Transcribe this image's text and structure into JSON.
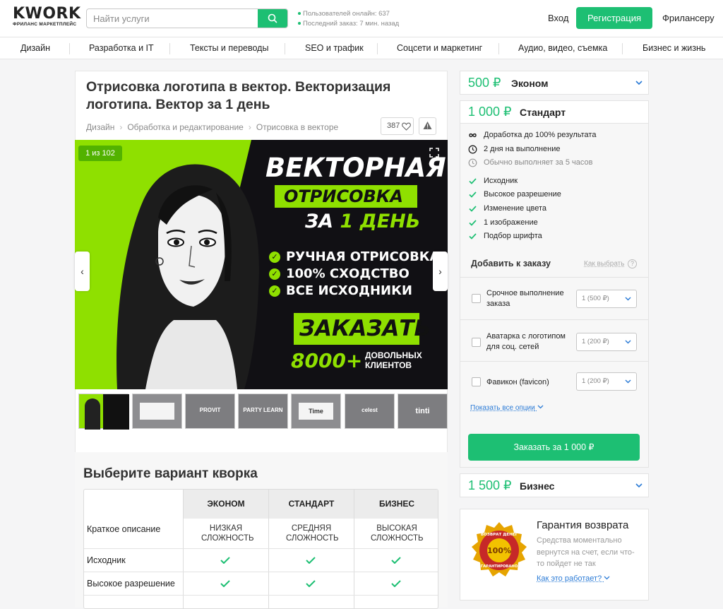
{
  "header": {
    "logo": "KWORK",
    "logo_sub": "ФРИЛАНС МАРКЕТПЛЕЙС",
    "search_placeholder": "Найти услуги",
    "stats_online": "Пользователей онлайн: 637",
    "stats_last_order": "Последний заказ: 7 мин. назад",
    "login": "Вход",
    "register": "Регистрация",
    "freelancer": "Фрилансеру"
  },
  "categories": [
    "Дизайн",
    "Разработка и IT",
    "Тексты и переводы",
    "SEO и трафик",
    "Соцсети и маркетинг",
    "Аудио, видео, съемка",
    "Бизнес и жизнь"
  ],
  "kwork": {
    "title": "Отрисовка логотипа в вектор. Векторизация логотипа. Вектор за 1 день",
    "breadcrumbs": [
      "Дизайн",
      "Обработка и редактирование",
      "Отрисовка в векторе"
    ],
    "favorites": "387",
    "gallery_counter": "1 из 102"
  },
  "banner": {
    "line1": "ВЕКТОРНАЯ",
    "line2": "ОТРИСОВКА",
    "line3a": "ЗА",
    "line3b": "1",
    "line3c": "ДЕНЬ",
    "bullets": [
      "РУЧНАЯ ОТРИСОВКА",
      "100% СХОДСТВО",
      "ВСЕ ИСХОДНИКИ"
    ],
    "cta": "ЗАКАЗАТЬ",
    "clients_num": "8000+",
    "clients_text1": "ДОВОЛЬНЫХ",
    "clients_text2": "КЛИЕНТОВ"
  },
  "thumbs": [
    "",
    "",
    "PROVIT",
    "PARTY LEARN",
    "Time",
    "celest",
    "tinti"
  ],
  "packages": {
    "title": "Выберите вариант кворка",
    "columns": [
      "ЭКОНОМ",
      "СТАНДАРТ",
      "БИЗНЕС"
    ],
    "rows": [
      {
        "label": "Краткое описание",
        "values": [
          "НИЗКАЯ СЛОЖНОСТЬ",
          "СРЕДНЯЯ СЛОЖНОСТЬ",
          "ВЫСОКАЯ СЛОЖНОСТЬ"
        ]
      },
      {
        "label": "Исходник",
        "values": [
          "check",
          "check",
          "check"
        ]
      },
      {
        "label": "Высокое разрешение",
        "values": [
          "check",
          "check",
          "check"
        ]
      }
    ]
  },
  "tiers": {
    "econom": {
      "price": "500 ₽",
      "name": "Эконом"
    },
    "standard": {
      "price": "1 000 ₽",
      "name": "Стандарт"
    },
    "business": {
      "price": "1 500 ₽",
      "name": "Бизнес"
    }
  },
  "standard_features": [
    {
      "icon": "infinity-icon",
      "text": "Доработка до 100% результата"
    },
    {
      "icon": "clock-icon",
      "text": "2 дня на выполнение"
    },
    {
      "icon": "clock-icon",
      "text": "Обычно выполняет за 5 часов",
      "muted": true
    },
    {
      "icon": "check-icon",
      "text": "Исходник"
    },
    {
      "icon": "check-icon",
      "text": "Высокое разрешение"
    },
    {
      "icon": "check-icon",
      "text": "Изменение цвета"
    },
    {
      "icon": "check-icon",
      "text": "1 изображение"
    },
    {
      "icon": "check-icon",
      "text": "Подбор шрифта"
    }
  ],
  "addons": {
    "title": "Добавить к заказу",
    "how_to_choose": "Как выбрать",
    "options": [
      {
        "text": "Срочное выполнение заказа",
        "select": "1 (500 ₽)"
      },
      {
        "text": "Аватарка с логотипом для соц. сетей",
        "select": "1 (200 ₽)"
      },
      {
        "text": "Фавикон (favicon)",
        "select": "1 (200 ₽)"
      }
    ],
    "show_all": "Показать все опции"
  },
  "order_button": "Заказать за 1 000 ₽",
  "guarantee": {
    "title": "Гарантия возврата",
    "text": "Средства моментально вернутся на счет, если что-то пойдет не так",
    "link": "Как это работает?",
    "seal_top": "ВОЗВРАТ ДЕНЕГ",
    "seal_center": "100%",
    "seal_bottom": "ГАРАНТИРОВАНО"
  },
  "colors": {
    "accent": "#1dbf73",
    "banner_green": "#8fe000",
    "link": "#2b7bd6"
  }
}
